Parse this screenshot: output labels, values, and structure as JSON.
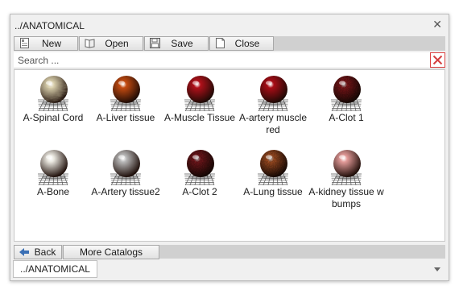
{
  "window": {
    "title": "../ANATOMICAL"
  },
  "toolbar": {
    "new_label": "New",
    "open_label": "Open",
    "save_label": "Save",
    "close_label": "Close"
  },
  "search": {
    "placeholder": "Search ..."
  },
  "materials": [
    {
      "label": "A-Spinal Cord",
      "color": "#ddd3b0",
      "texture": "marble"
    },
    {
      "label": "A-Liver tissue",
      "color": "#c24a10",
      "texture": "smooth"
    },
    {
      "label": "A-Muscle Tissue",
      "color": "#b0101a",
      "texture": "smooth"
    },
    {
      "label": "A-artery muscle red",
      "color": "#a80c16",
      "texture": "smooth"
    },
    {
      "label": "A-Clot 1",
      "color": "#9a1a1e",
      "texture": "grainy"
    },
    {
      "label": "A-Bone",
      "color": "#eae8e0",
      "texture": "smooth"
    },
    {
      "label": "A-Artery tissue2",
      "color": "#b8b8b8",
      "texture": "smooth"
    },
    {
      "label": "A-Clot 2",
      "color": "#8e1c22",
      "texture": "grainy"
    },
    {
      "label": "A-Lung tissue",
      "color": "#c8602a",
      "texture": "grainy"
    },
    {
      "label": "A-kidney tissue w bumps",
      "color": "#e29a98",
      "texture": "smooth"
    }
  ],
  "bottombar": {
    "back_label": "Back",
    "more_label": "More Catalogs"
  },
  "pathbar": {
    "path": "../ANATOMICAL"
  },
  "colors": {
    "accent": "#3a6fb5",
    "clear": "#d44040"
  },
  "icons": {
    "close": "close-icon",
    "new": "new-doc-icon",
    "open": "open-book-icon",
    "save": "save-disk-icon",
    "close_doc": "close-doc-icon",
    "clear": "clear-search-icon",
    "back": "back-arrow-icon",
    "dropdown": "chevron-down-icon"
  }
}
